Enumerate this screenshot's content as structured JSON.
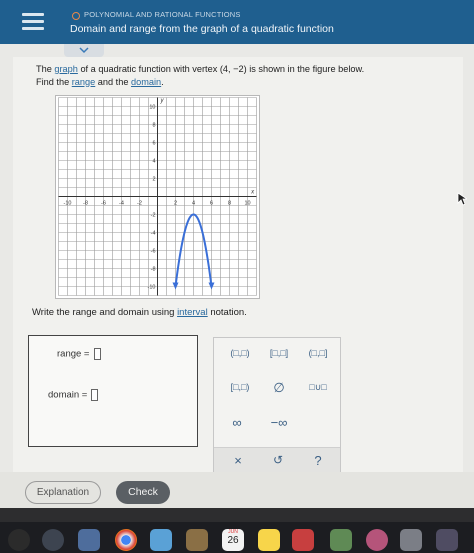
{
  "header": {
    "topic": "POLYNOMIAL AND RATIONAL FUNCTIONS",
    "title": "Domain and range from the graph of a quadratic function"
  },
  "problem": {
    "part1": "The ",
    "link1": "graph",
    "part2": " of a quadratic function with vertex ",
    "vertex": "(4, −2)",
    "part3": " is shown in the figure below.",
    "part4": "Find the ",
    "link2": "range",
    "part5": " and the ",
    "link3": "domain",
    "part6": "."
  },
  "graph": {
    "y_label": "y",
    "x_label": "x",
    "x_ticks": [
      "-10",
      "-8",
      "-6",
      "-4",
      "-2",
      "2",
      "4",
      "6",
      "8",
      "10"
    ],
    "y_ticks": [
      "10",
      "8",
      "6",
      "4",
      "2",
      "-2",
      "-4",
      "-6",
      "-8",
      "-10"
    ]
  },
  "instruction": {
    "part1": "Write the range and domain using ",
    "link": "interval",
    "part2": " notation."
  },
  "answers": {
    "range_label": "range =",
    "domain_label": "domain ="
  },
  "keypad": {
    "row1": [
      "(□,□)",
      "[□,□]",
      "(□,□]"
    ],
    "row2": [
      "[□,□)",
      "∅",
      "□∪□"
    ],
    "row3": [
      "∞",
      "−∞"
    ],
    "actions": [
      "×",
      "↺",
      "?"
    ]
  },
  "buttons": {
    "explanation": "Explanation",
    "check": "Check"
  },
  "dock": {
    "calendar_month": "JUN",
    "calendar_day": "26"
  },
  "colors": {
    "header": "#1f5f8f",
    "link": "#2a6a9e",
    "curve": "#3a6fd8",
    "check_button": "#5a5f64"
  }
}
